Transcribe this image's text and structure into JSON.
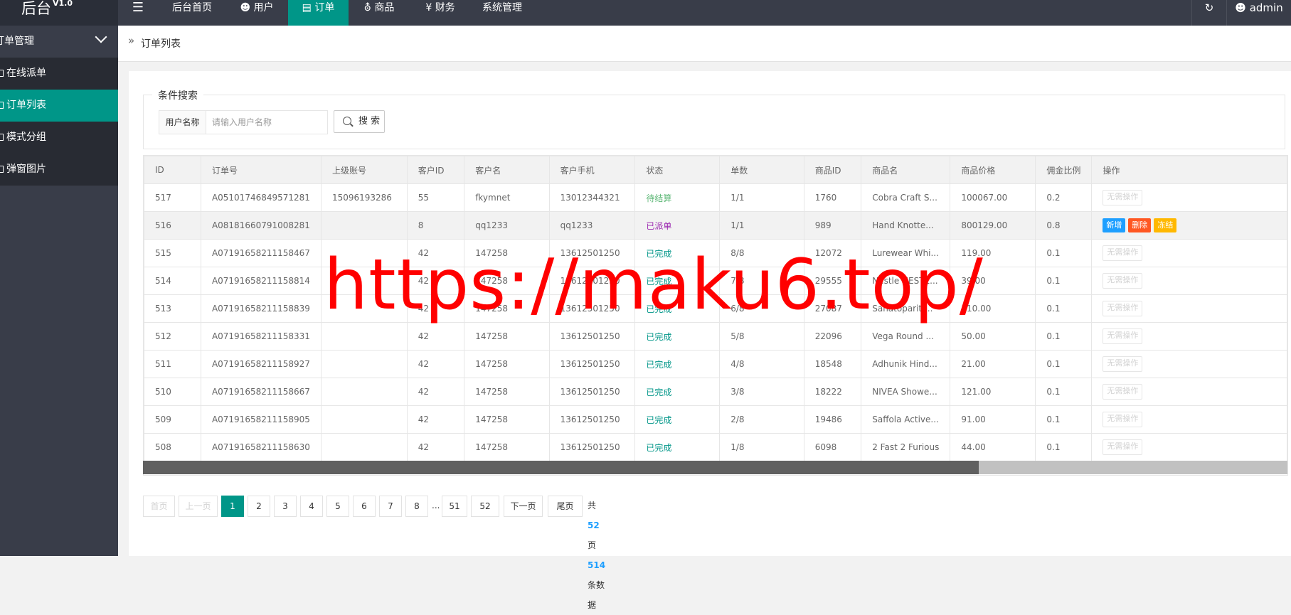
{
  "app": {
    "logo": "后台",
    "version": "V1.0"
  },
  "topnav": {
    "toggle_icon": "menu-icon",
    "items": [
      {
        "label": "后台首页",
        "icon": ""
      },
      {
        "label": "用户",
        "icon": "user-icon"
      },
      {
        "label": "订单",
        "icon": "file-icon",
        "active": true
      },
      {
        "label": "商品",
        "icon": "cart-icon"
      },
      {
        "label": "财务",
        "icon": "yen-icon"
      },
      {
        "label": "系统管理",
        "icon": ""
      }
    ],
    "refresh_icon": "refresh-icon",
    "user": "admin"
  },
  "sidebar": {
    "group": "订单管理",
    "items": [
      {
        "label": "在线派单"
      },
      {
        "label": "订单列表",
        "active": true
      },
      {
        "label": "模式分组"
      },
      {
        "label": "弹窗图片"
      }
    ]
  },
  "breadcrumb": {
    "current": "订单列表"
  },
  "search": {
    "legend": "条件搜索",
    "label": "用户名称",
    "placeholder": "请输入用户名称",
    "value": "",
    "button": "搜 索"
  },
  "table": {
    "columns": [
      "ID",
      "订单号",
      "上级账号",
      "客户ID",
      "客户名",
      "客户手机",
      "状态",
      "单数",
      "商品ID",
      "商品名",
      "商品价格",
      "佣金比例",
      "操作"
    ],
    "rows": [
      {
        "id": "517",
        "order": "A05101746849571281",
        "parent": "15096193286",
        "cid": "55",
        "cname": "fkymnet",
        "phone": "13012344321",
        "status": "待结算",
        "status_type": "pending",
        "count": "1/1",
        "pid": "1760",
        "pname": "Cobra Craft S...",
        "price": "100067.00",
        "rate": "0.2",
        "ops": [
          "无需操作"
        ]
      },
      {
        "id": "516",
        "order": "A08181660791008281",
        "parent": "",
        "cid": "8",
        "cname": "qq1233",
        "phone": "qq1233",
        "status": "已派单",
        "status_type": "dispatch",
        "count": "1/1",
        "pid": "989",
        "pname": "Hand Knotte...",
        "price": "800129.00",
        "rate": "0.8",
        "ops": [
          "新增",
          "删除",
          "冻结"
        ]
      },
      {
        "id": "515",
        "order": "A07191658211158467",
        "parent": "",
        "cid": "42",
        "cname": "147258",
        "phone": "13612501250",
        "status": "已完成",
        "status_type": "done",
        "count": "8/8",
        "pid": "12072",
        "pname": "Lurewear Whi...",
        "price": "119.00",
        "rate": "0.1",
        "ops": [
          "无需操作"
        ]
      },
      {
        "id": "514",
        "order": "A07191658211158814",
        "parent": "",
        "cid": "42",
        "cname": "147258",
        "phone": "13612501250",
        "status": "已完成",
        "status_type": "done",
        "count": "7/8",
        "pid": "29555",
        "pname": "Nestle NESTE...",
        "price": "39.00",
        "rate": "0.1",
        "ops": [
          "无需操作"
        ]
      },
      {
        "id": "513",
        "order": "A07191658211158839",
        "parent": "",
        "cid": "42",
        "cname": "147258",
        "phone": "13612501250",
        "status": "已完成",
        "status_type": "done",
        "count": "6/8",
        "pid": "27087",
        "pname": "Sanatoparitr...",
        "price": "110.00",
        "rate": "0.1",
        "ops": [
          "无需操作"
        ]
      },
      {
        "id": "512",
        "order": "A07191658211158331",
        "parent": "",
        "cid": "42",
        "cname": "147258",
        "phone": "13612501250",
        "status": "已完成",
        "status_type": "done",
        "count": "5/8",
        "pid": "22096",
        "pname": "Vega Round ...",
        "price": "50.00",
        "rate": "0.1",
        "ops": [
          "无需操作"
        ]
      },
      {
        "id": "511",
        "order": "A07191658211158927",
        "parent": "",
        "cid": "42",
        "cname": "147258",
        "phone": "13612501250",
        "status": "已完成",
        "status_type": "done",
        "count": "4/8",
        "pid": "18548",
        "pname": "Adhunik Hind...",
        "price": "21.00",
        "rate": "0.1",
        "ops": [
          "无需操作"
        ]
      },
      {
        "id": "510",
        "order": "A07191658211158667",
        "parent": "",
        "cid": "42",
        "cname": "147258",
        "phone": "13612501250",
        "status": "已完成",
        "status_type": "done",
        "count": "3/8",
        "pid": "18222",
        "pname": "NIVEA Showe...",
        "price": "121.00",
        "rate": "0.1",
        "ops": [
          "无需操作"
        ]
      },
      {
        "id": "509",
        "order": "A07191658211158905",
        "parent": "",
        "cid": "42",
        "cname": "147258",
        "phone": "13612501250",
        "status": "已完成",
        "status_type": "done",
        "count": "2/8",
        "pid": "19486",
        "pname": "Saffola Active...",
        "price": "91.00",
        "rate": "0.1",
        "ops": [
          "无需操作"
        ]
      },
      {
        "id": "508",
        "order": "A07191658211158630",
        "parent": "",
        "cid": "42",
        "cname": "147258",
        "phone": "13612501250",
        "status": "已完成",
        "status_type": "done",
        "count": "1/8",
        "pid": "6098",
        "pname": "2 Fast 2 Furious",
        "price": "44.00",
        "rate": "0.1",
        "ops": [
          "无需操作"
        ]
      }
    ],
    "horizontal_scroll_fraction": 0.73
  },
  "pager": {
    "first": "首页",
    "prev": "上一页",
    "pages": [
      "1",
      "2",
      "3",
      "4",
      "5",
      "6",
      "7",
      "8"
    ],
    "current": "1",
    "ellipsis": "...",
    "tail_pages": [
      "51",
      "52"
    ],
    "next": "下一页",
    "last": "尾页",
    "total_prefix": "共",
    "total_pages": "52",
    "pages_suffix": "页",
    "total_records": "514",
    "records_suffix": "条数据"
  },
  "watermark": "https://maku6.top/",
  "colors": {
    "topbar": "#393d49",
    "accent": "#009688",
    "blue": "#1e9fff",
    "red": "#ff5722",
    "orange": "#ffb800"
  }
}
